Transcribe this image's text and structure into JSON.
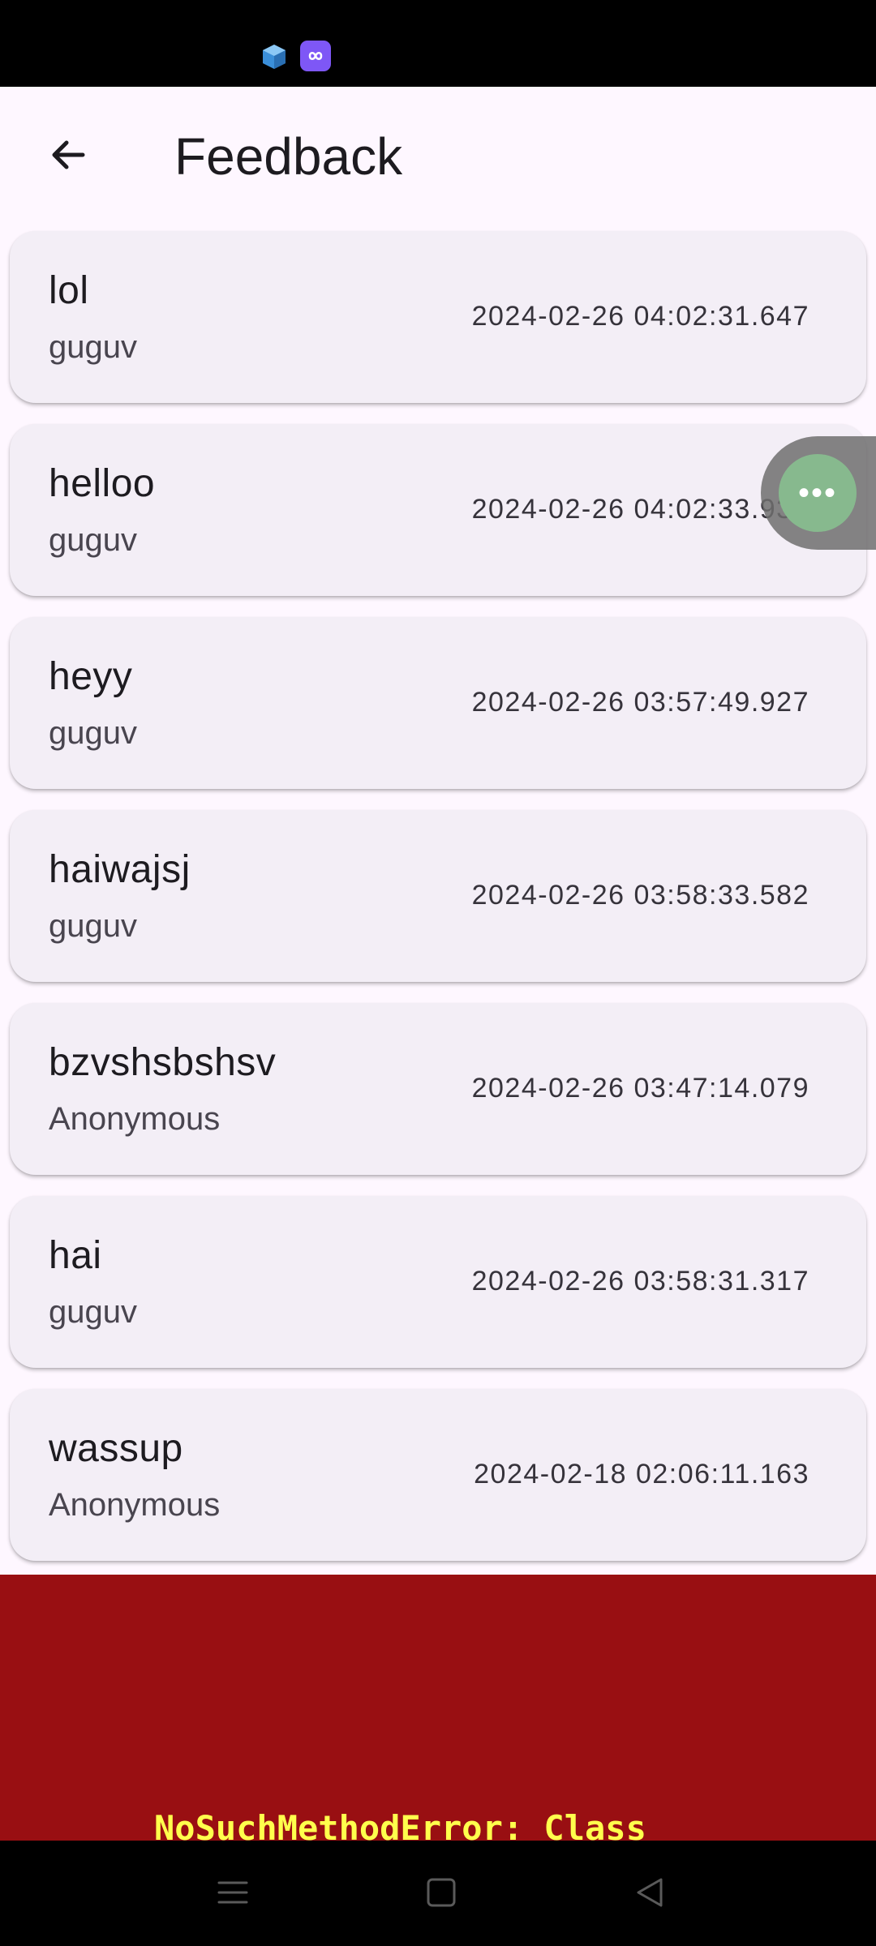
{
  "app_bar": {
    "title": "Feedback"
  },
  "feedback": [
    {
      "title": "lol",
      "author": "guguv",
      "timestamp": "2024-02-26 04:02:31.647"
    },
    {
      "title": "helloo",
      "author": "guguv",
      "timestamp": "2024-02-26 04:02:33.939"
    },
    {
      "title": "heyy",
      "author": "guguv",
      "timestamp": "2024-02-26 03:57:49.927"
    },
    {
      "title": "haiwajsj",
      "author": "guguv",
      "timestamp": "2024-02-26 03:58:33.582"
    },
    {
      "title": "bzvshsbshsv",
      "author": "Anonymous",
      "timestamp": "2024-02-26 03:47:14.079"
    },
    {
      "title": "hai",
      "author": "guguv",
      "timestamp": "2024-02-26 03:58:31.317"
    },
    {
      "title": "wassup",
      "author": "Anonymous",
      "timestamp": "2024-02-18 02:06:11.163"
    }
  ],
  "floating_bubble": {
    "label": "•••"
  },
  "error": {
    "message": "NoSuchMethodError: Class"
  },
  "colors": {
    "background": "#fef7ff",
    "card": "#f3eef6",
    "error_background": "#990f12",
    "error_text": "#ffff4c",
    "bubble": "#87b98e"
  },
  "icons": {
    "back": "arrow-left-icon",
    "status_app_1": "cube-app-icon",
    "status_app_2": "infinity-app-icon",
    "nav_recents": "menu-lines-icon",
    "nav_home": "square-icon",
    "nav_back": "triangle-back-icon"
  }
}
